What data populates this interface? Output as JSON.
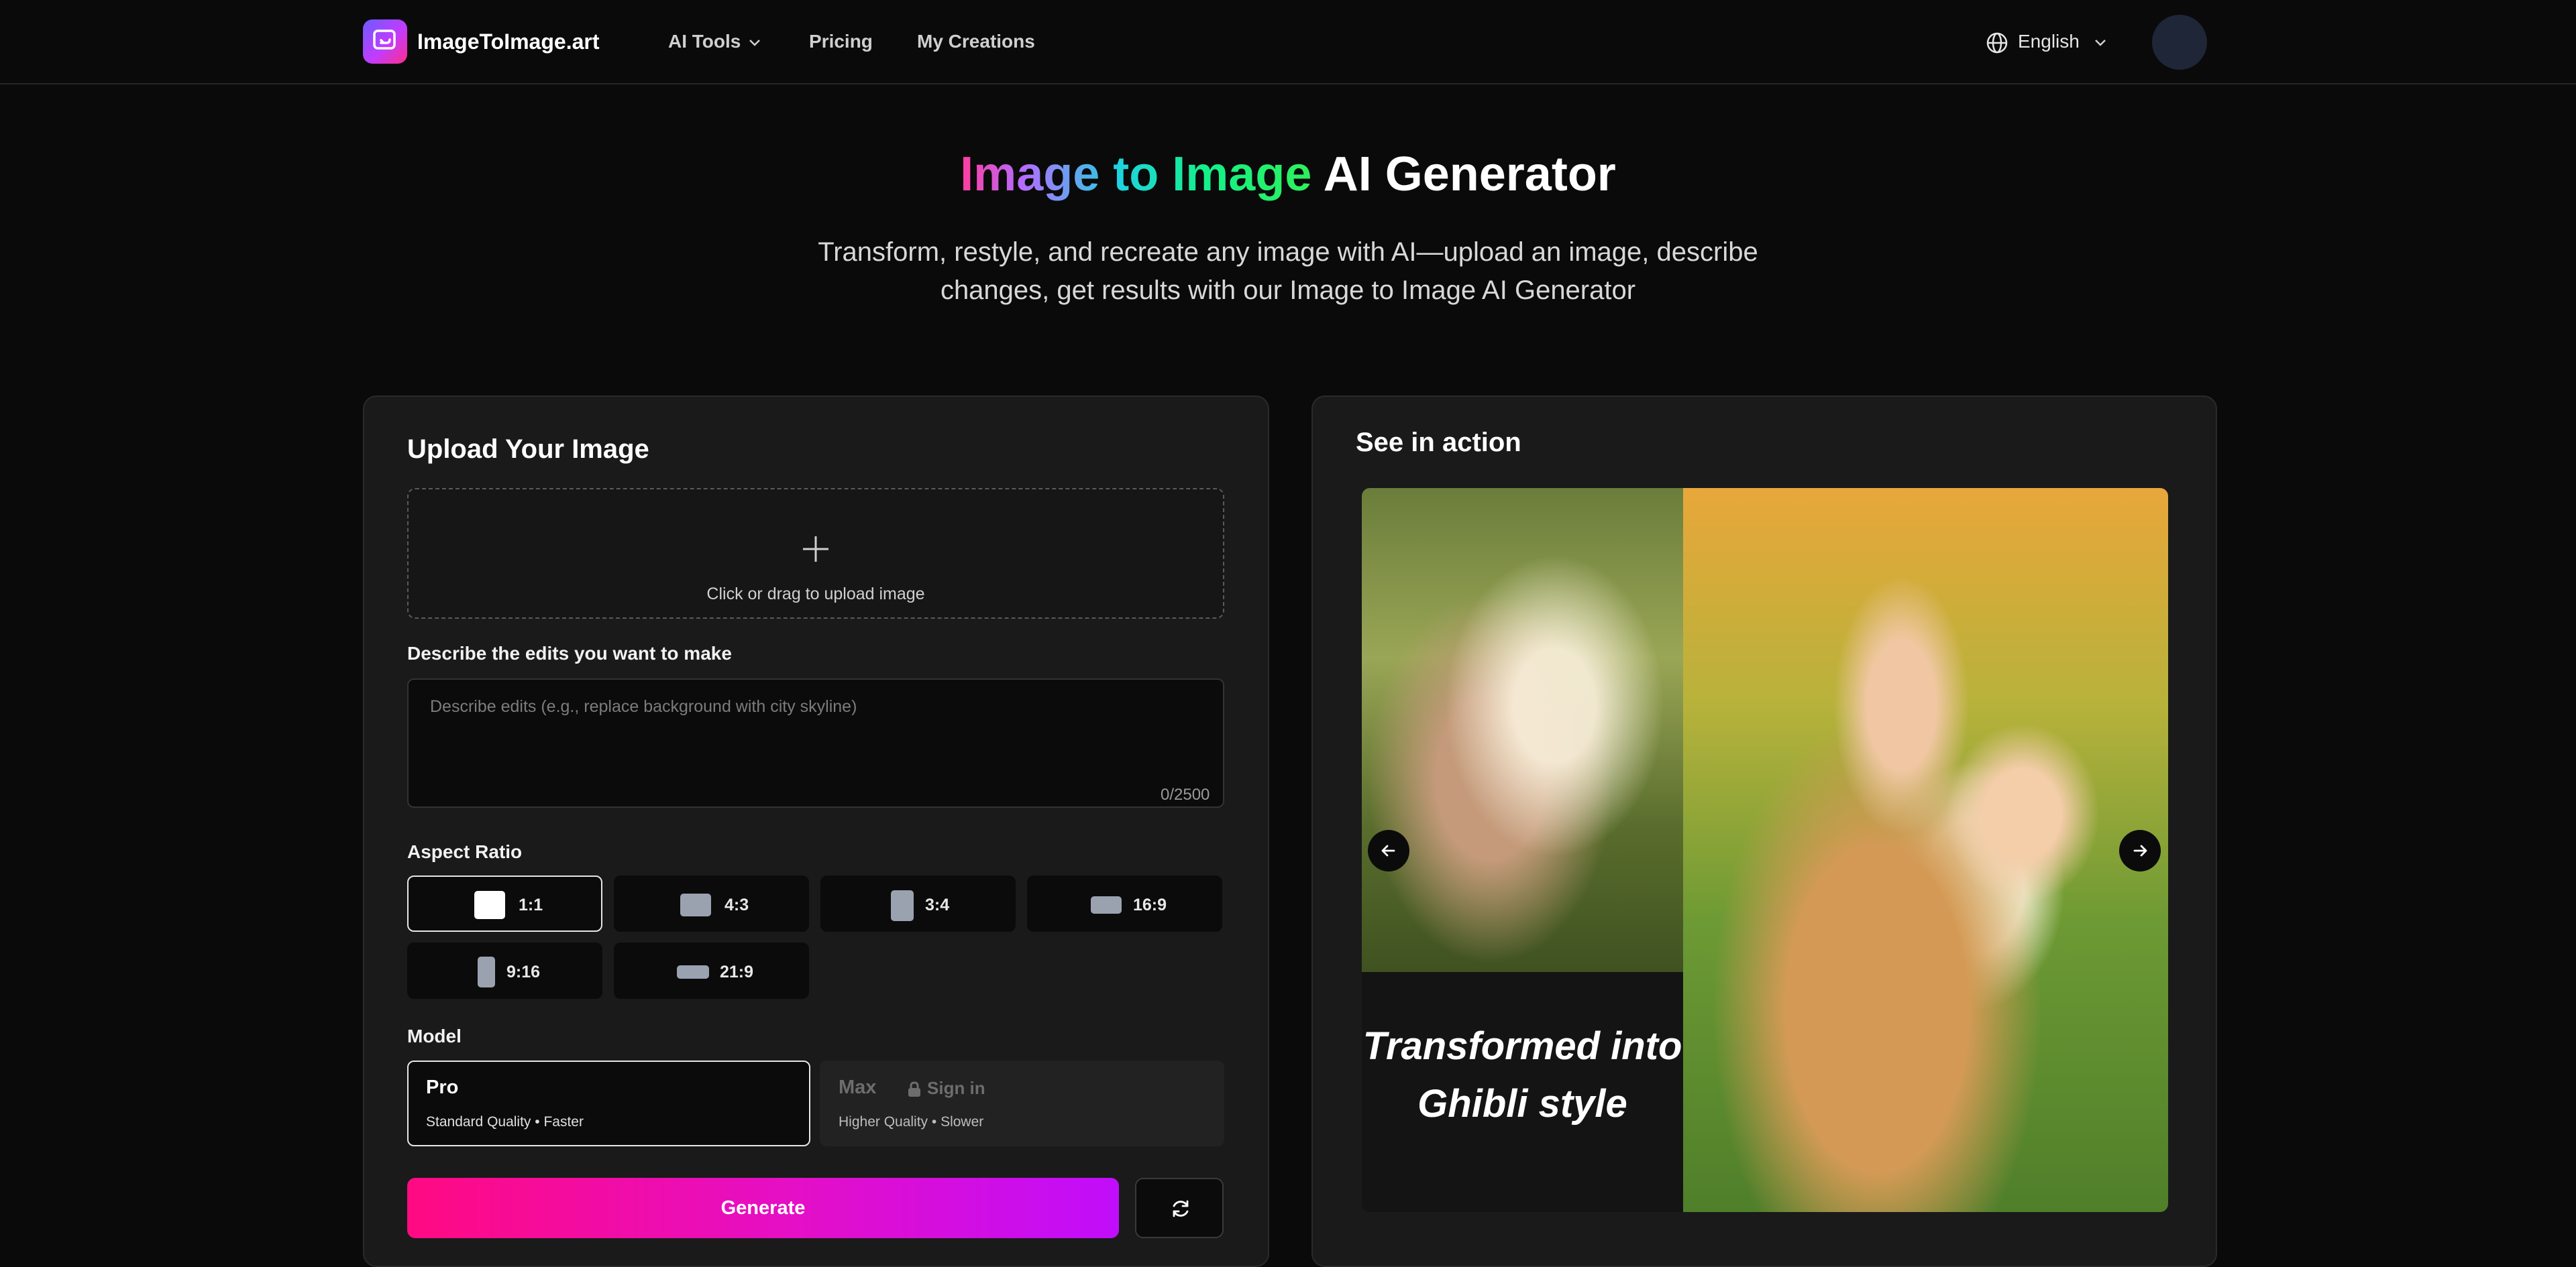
{
  "nav": {
    "brand": "ImageToImage.art",
    "links": [
      "AI Tools",
      "Pricing",
      "My Creations"
    ],
    "language": "English"
  },
  "hero": {
    "title_part1": "Image",
    "title_part2": "to",
    "title_part3": "Image",
    "title_part4": "AI Generator",
    "subtitle": "Transform, restyle, and recreate any image with AI—upload an image, describe changes, get results with our Image to Image AI Generator"
  },
  "form": {
    "heading": "Upload Your Image",
    "upload_text": "Click or drag to upload image",
    "describe_label": "Describe the edits you want to make",
    "describe_placeholder": "Describe edits (e.g., replace background with city skyline)",
    "describe_counter": "0/2500",
    "aspect_label": "Aspect Ratio",
    "ratios": [
      "1:1",
      "4:3",
      "3:4",
      "16:9",
      "9:16",
      "21:9"
    ],
    "selected_ratio": "1:1",
    "model_label": "Model",
    "models": [
      {
        "name": "Pro",
        "desc": "Standard Quality • Faster"
      },
      {
        "name": "Max",
        "desc": "Higher Quality • Slower",
        "lock_text": "Sign in"
      }
    ],
    "generate_label": "Generate"
  },
  "showcase": {
    "heading": "See in action",
    "caption": "Transformed into Ghibli style"
  },
  "colors": {
    "accent_pink": "#ff0a82",
    "accent_purple": "#c10dfb",
    "background": "#0a0a0a",
    "panel": "#1a1a1a"
  }
}
